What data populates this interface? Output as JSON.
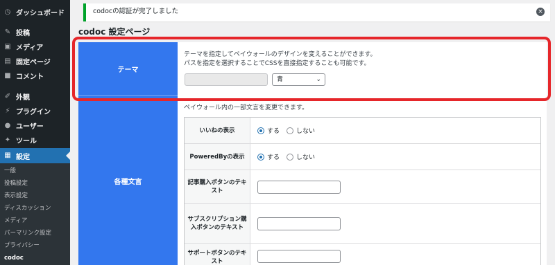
{
  "sidebar": {
    "items": [
      {
        "label": "ダッシュボード",
        "icon": "dashboard-icon",
        "glyph": "◷"
      },
      {
        "label": "投稿",
        "icon": "pin-icon",
        "glyph": "✎"
      },
      {
        "label": "メディア",
        "icon": "media-icon",
        "glyph": "▣"
      },
      {
        "label": "固定ページ",
        "icon": "page-icon",
        "glyph": "▤"
      },
      {
        "label": "コメント",
        "icon": "comment-icon",
        "glyph": "■"
      },
      {
        "label": "外観",
        "icon": "appearance-icon",
        "glyph": "✐"
      },
      {
        "label": "プラグイン",
        "icon": "plugin-icon",
        "glyph": "⚡"
      },
      {
        "label": "ユーザー",
        "icon": "user-icon",
        "glyph": "●"
      },
      {
        "label": "ツール",
        "icon": "tool-icon",
        "glyph": "✦"
      },
      {
        "label": "設定",
        "icon": "settings-icon",
        "glyph": "▦"
      }
    ],
    "submenu": [
      "一般",
      "投稿設定",
      "表示設定",
      "ディスカッション",
      "メディア",
      "パーマリンク設定",
      "プライバシー",
      "codoc"
    ]
  },
  "notice": {
    "text": "codocの認証が完了しました",
    "close_glyph": "×"
  },
  "page_title": "codoc 設定ページ",
  "theme": {
    "heading": "テーマ",
    "desc_line1": "テーマを指定してペイウォールのデザインを変えることができます。",
    "desc_line2": "パスを指定を選択することでCSSを直接指定することも可能です。",
    "css_value": "",
    "select_value": "青"
  },
  "texts": {
    "heading": "各種文言",
    "desc": "ペイウォール内の一部文言を変更できます。",
    "rows": [
      {
        "label": "いいねの表示",
        "options": [
          "する",
          "しない"
        ],
        "selected": "する"
      },
      {
        "label": "PoweredByの表示",
        "options": [
          "する",
          "しない"
        ],
        "selected": "する"
      },
      {
        "label": "記事購入ボタンのテキスト",
        "value": ""
      },
      {
        "label": "サブスクリプション購入ボタンのテキスト",
        "value": ""
      },
      {
        "label": "サポートボタンのテキスト",
        "value": ""
      }
    ]
  },
  "colors": {
    "accent": "#3377ee",
    "highlight": "#e6262a",
    "sidebar_bg": "#1d2327",
    "active": "#2271b1",
    "notice_border": "#00a32a"
  }
}
